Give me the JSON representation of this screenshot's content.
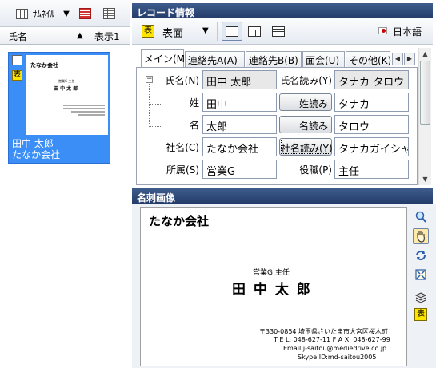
{
  "left": {
    "toolbar": {
      "view_label": "ｻﾑﾈｲﾙ",
      "dropdown_icon": "chevron-down-icon"
    },
    "columns": [
      {
        "label": "氏名",
        "sort": "▲"
      },
      {
        "label": "表示1"
      }
    ],
    "card": {
      "name": "田中 太郎",
      "company": "たなか会社",
      "badge": "表",
      "thumb_company": "たなか会社",
      "thumb_title": "営業G 主任",
      "thumb_name": "田 中 太 郎"
    }
  },
  "record": {
    "title": "レコード情報",
    "side_badge": "表",
    "side_select": "表面",
    "language": "日本語",
    "tabs": [
      "メイン(M)",
      "連絡先A(A)",
      "連絡先B(B)",
      "面会(U)",
      "その他(K)"
    ],
    "tab_scroll_left": "◀",
    "tab_scroll_right": "▶",
    "tree_toggle": "−",
    "fields": {
      "name_label": "氏名(N)",
      "name_value": "田中 太郎",
      "name_reading_label": "氏名読み(Y)",
      "name_reading_value": "タナカ タロウ",
      "last_label": "姓",
      "last_value": "田中",
      "last_reading_button": "姓読み",
      "last_reading_value": "タナカ",
      "first_label": "名",
      "first_value": "太郎",
      "first_reading_button": "名読み",
      "first_reading_value": "タロウ",
      "company_label": "社名(C)",
      "company_value": "たなか会社",
      "company_reading_button": "社名読み(Y)",
      "company_reading_value": "タナカガイシャ",
      "dept_label": "所属(S)",
      "dept_value": "営業G",
      "position_label": "役職(P)",
      "position_value": "主任"
    }
  },
  "image": {
    "title": "名刺画像",
    "card": {
      "company": "たなか会社",
      "title": "営業G 主任",
      "name": "田 中 太 郎",
      "address": "〒330-0854 埼玉県さいたま市大宮区桜木町",
      "phone": "T E L. 048-627-11    F A X. 048-627-99",
      "email": "Email:j-saitou@mediedrive.co.jp",
      "skype": "Skype ID:md-saitou2005"
    },
    "tools": {
      "zoom": "zoom-icon",
      "pan": "hand-icon",
      "rotate": "rotate-icon",
      "fit": "fit-icon",
      "layers": "layers-icon",
      "face": "表"
    }
  }
}
